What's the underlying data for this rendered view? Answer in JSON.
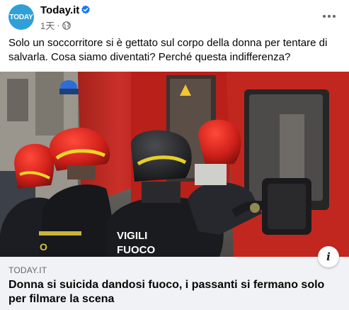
{
  "post": {
    "page_name": "Today.it",
    "avatar_text": "TODAY",
    "timestamp": "1天",
    "separator": "·",
    "audience_icon": "globe-icon",
    "verified_icon": "verified-badge-icon",
    "more_icon": "more-options-icon",
    "message": "Solo un soccorritore si è gettato sul corpo della donna per tentare di salvarla. Cosa siamo diventati? Perché questa indifferenza?"
  },
  "photo": {
    "description_icon": "firefighters-photo",
    "jacket_text_line1": "VIGILI",
    "jacket_text_line2": "FUOCO",
    "jacket_text_left": "O"
  },
  "link_preview": {
    "domain": "TODAY.IT",
    "headline": "Donna si suicida dandosi fuoco, i passanti si fermano solo per filmare la scena",
    "info_label": "i"
  },
  "colors": {
    "brand_blue": "#2f9fd8",
    "verified_blue": "#1877f2",
    "secondary_text": "#65676b",
    "preview_bg": "#f0f2f5"
  }
}
